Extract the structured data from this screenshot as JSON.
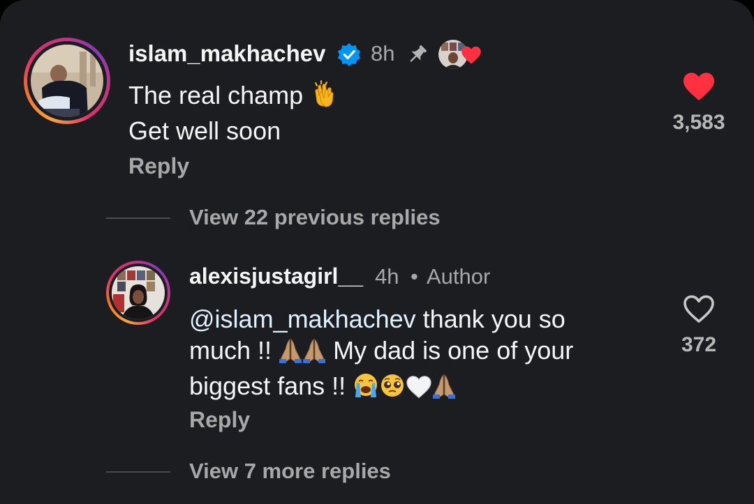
{
  "comments": [
    {
      "username": "islam_makhachev",
      "verified": true,
      "time": "8h",
      "pinned": true,
      "liked_by_author": true,
      "lines": [
        "The real champ",
        "Get well soon"
      ],
      "reply_label": "Reply",
      "like_count": "3,583",
      "liked": true
    },
    {
      "username": "alexisjustagirl__",
      "time": "4h",
      "separator": "•",
      "badge": "Author",
      "mention": "@islam_makhachev",
      "line1_rest": " thank you so",
      "line2_start": "much !!",
      "line2_rest": "My dad is one of your",
      "line3_start": "biggest fans !!",
      "reply_label": "Reply",
      "like_count": "372",
      "liked": false
    }
  ],
  "view_previous_replies": "View 22 previous replies",
  "view_more_replies": "View 7 more replies",
  "colors": {
    "background": "#1c1d21",
    "like_red": "#ff3040",
    "verified_blue": "#0095f6",
    "secondary_text": "#a8a8a8"
  },
  "icons": [
    "verified-badge-icon",
    "pin-icon",
    "heart-filled-icon",
    "heart-outline-icon",
    "clap-emoji",
    "pray-emoji",
    "crying-emoji",
    "pleading-emoji",
    "white-heart-emoji"
  ]
}
